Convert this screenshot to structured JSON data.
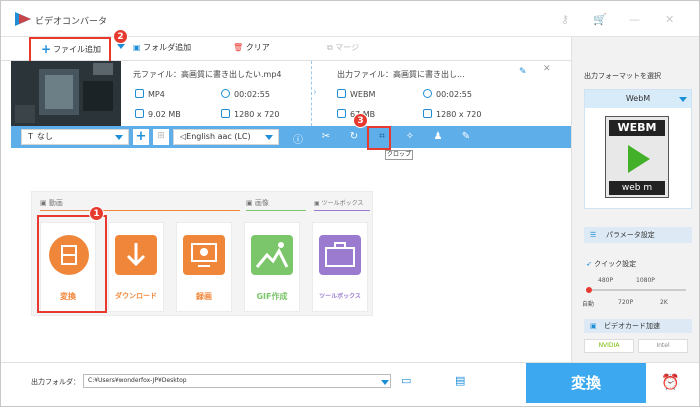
{
  "app": {
    "title": "ビデオコンバータ"
  },
  "toolbar": {
    "add_file": "ファイル追加",
    "add_folder": "フォルダ追加",
    "clear": "クリア",
    "merge": "マージ"
  },
  "badges": {
    "one": "1",
    "two": "2",
    "three": "3"
  },
  "file": {
    "source_label": "元ファイル：高画質に書き出したい.mp4",
    "source_format": "MP4",
    "source_duration": "00:02:55",
    "source_size": "9.02 MB",
    "source_resolution": "1280 x 720",
    "output_label": "出力ファイル：高画質に書き出し...",
    "output_format": "WEBM",
    "output_duration": "00:02:55",
    "output_size": "67 MB",
    "output_resolution": "1280 x 720"
  },
  "editbar": {
    "subtitle": "なし",
    "audio": "English aac (LC)",
    "tooltip": "クロップ"
  },
  "panel": {
    "sections": {
      "video": "動画",
      "image": "画像",
      "toolbox": "ツールボックス"
    },
    "tools": [
      {
        "label": "変換",
        "color": "#f0863a"
      },
      {
        "label": "ダウンロード",
        "color": "#f0863a"
      },
      {
        "label": "録画",
        "color": "#f0863a"
      },
      {
        "label": "GIF作成",
        "color": "#7bc56a"
      },
      {
        "label": "ツールボックス",
        "color": "#9b7bd0"
      }
    ]
  },
  "right": {
    "format_label": "出力フォーマットを選択",
    "format_value": "WebM",
    "format_badge": "WEBM",
    "format_caption": "web m",
    "param_button": "パラメータ設定",
    "quick_label": "クイック設定",
    "ticks_top": [
      "480P",
      "1080P"
    ],
    "ticks_bottom": [
      "自動",
      "720P",
      "2K"
    ],
    "gpu_label": "ビデオカード加速",
    "gpu_vendors": [
      "NVIDIA",
      "Intel"
    ]
  },
  "bottom": {
    "folder_label": "出力フォルダ：",
    "folder_path": "C:¥Users¥wonderfox-JP¥Desktop",
    "convert_button": "変換"
  },
  "colors": {
    "accent": "#1e8fd7",
    "blue_bar": "#5daee9",
    "highlight": "#e8392f",
    "convert": "#3ba8f0"
  }
}
